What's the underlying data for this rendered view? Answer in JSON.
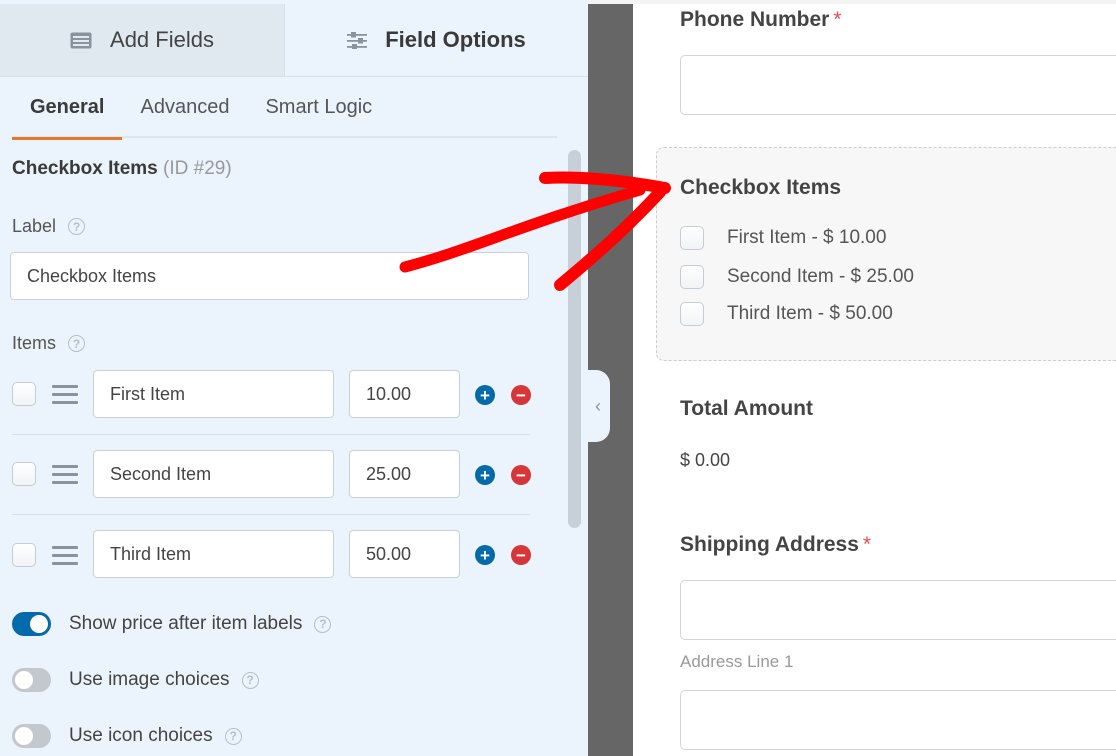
{
  "panel": {
    "tabs": [
      {
        "label": "Add Fields",
        "icon": "list-icon",
        "active": false
      },
      {
        "label": "Field Options",
        "icon": "sliders-icon",
        "active": true
      }
    ],
    "sub_tabs": [
      {
        "label": "General",
        "active": true
      },
      {
        "label": "Advanced",
        "active": false
      },
      {
        "label": "Smart Logic",
        "active": false
      }
    ],
    "field_name": "Checkbox Items",
    "field_id": "(ID #29)",
    "label_caption": "Label",
    "label_value": "Checkbox Items",
    "items_caption": "Items",
    "items": [
      {
        "name": "First Item",
        "price": "10.00"
      },
      {
        "name": "Second Item",
        "price": "25.00"
      },
      {
        "name": "Third Item",
        "price": "50.00"
      }
    ],
    "toggles": [
      {
        "label": "Show price after item labels",
        "on": true
      },
      {
        "label": "Use image choices",
        "on": false
      },
      {
        "label": "Use icon choices",
        "on": false
      }
    ],
    "help_glyph": "?",
    "collapse_glyph": "‹"
  },
  "preview": {
    "phone_label": "Phone Number",
    "required_mark": "*",
    "checkbox_label": "Checkbox Items",
    "checkbox_options": [
      "First Item - $ 10.00",
      "Second Item - $ 25.00",
      "Third Item - $ 50.00"
    ],
    "total_label": "Total Amount",
    "total_value": "$ 0.00",
    "shipping_label": "Shipping Address",
    "address_line1_sublabel": "Address Line 1"
  },
  "annotation": {
    "type": "red-arrow",
    "color": "#ff0000"
  },
  "colors": {
    "accent_blue": "#036aab",
    "remove_red": "#d63638",
    "active_tab_underline": "#e27730",
    "panel_bg": "#ebf3fc"
  }
}
